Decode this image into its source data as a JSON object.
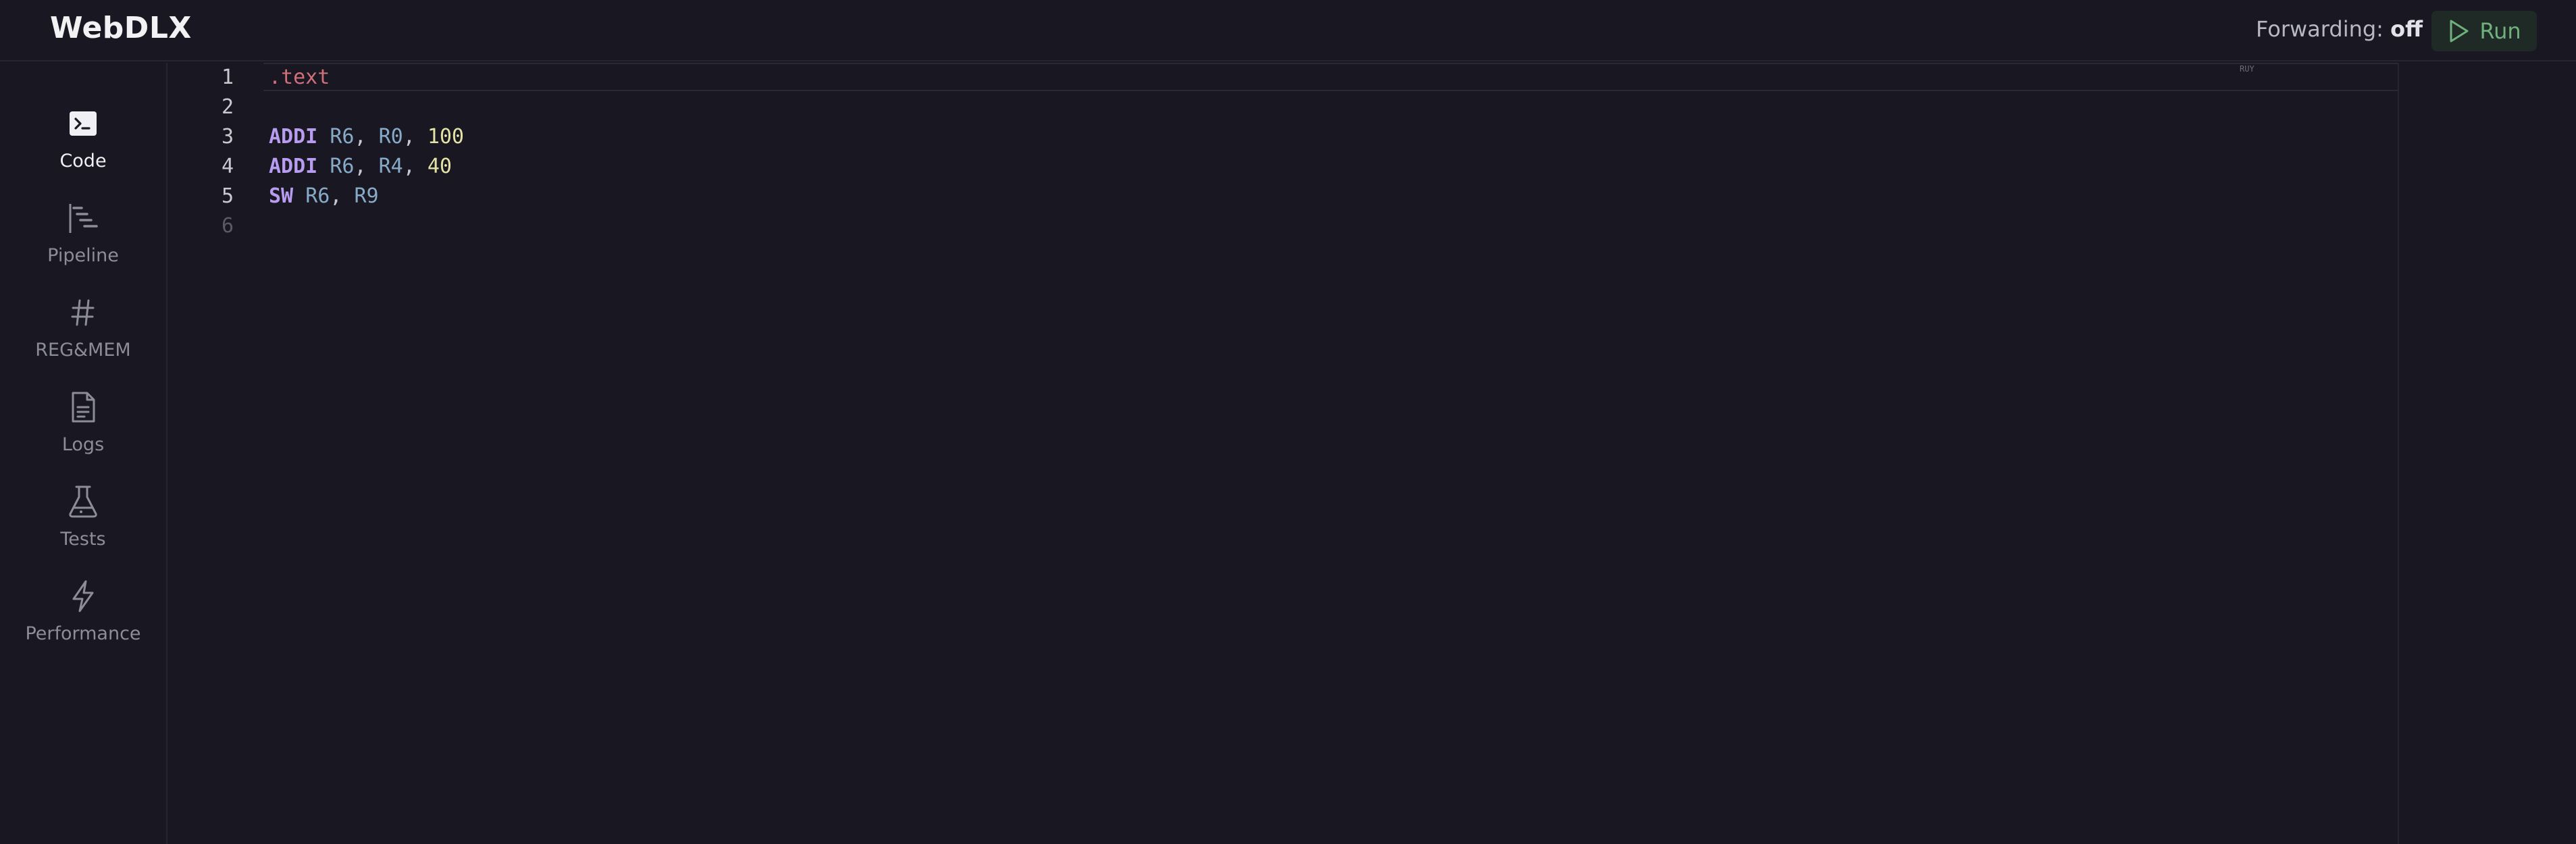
{
  "header": {
    "brand": "WebDLX",
    "forwarding_label": "Forwarding:",
    "forwarding_value": "off",
    "run_label": "Run"
  },
  "sidebar": {
    "items": [
      {
        "label": "Code",
        "icon": "terminal-icon",
        "active": true
      },
      {
        "label": "Pipeline",
        "icon": "pipeline-icon",
        "active": false
      },
      {
        "label": "REG&MEM",
        "icon": "hash-icon",
        "active": false
      },
      {
        "label": "Logs",
        "icon": "file-text-icon",
        "active": false
      },
      {
        "label": "Tests",
        "icon": "flask-icon",
        "active": false
      },
      {
        "label": "Performance",
        "icon": "zap-icon",
        "active": false
      }
    ]
  },
  "editor": {
    "minimap_text": "RUY",
    "lines": [
      {
        "number": "1",
        "tokens": [
          {
            "t": ".text",
            "k": "dir"
          }
        ]
      },
      {
        "number": "2",
        "tokens": []
      },
      {
        "number": "3",
        "tokens": [
          {
            "t": "ADDI",
            "k": "kw"
          },
          {
            "t": " ",
            "k": "pun"
          },
          {
            "t": "R6",
            "k": "reg"
          },
          {
            "t": ", ",
            "k": "pun"
          },
          {
            "t": "R0",
            "k": "reg"
          },
          {
            "t": ", ",
            "k": "pun"
          },
          {
            "t": "100",
            "k": "num"
          }
        ]
      },
      {
        "number": "4",
        "tokens": [
          {
            "t": "ADDI",
            "k": "kw"
          },
          {
            "t": " ",
            "k": "pun"
          },
          {
            "t": "R6",
            "k": "reg"
          },
          {
            "t": ", ",
            "k": "pun"
          },
          {
            "t": "R4",
            "k": "reg"
          },
          {
            "t": ", ",
            "k": "pun"
          },
          {
            "t": "40",
            "k": "num"
          }
        ]
      },
      {
        "number": "5",
        "tokens": [
          {
            "t": "SW",
            "k": "kw"
          },
          {
            "t": " ",
            "k": "pun"
          },
          {
            "t": "R6",
            "k": "reg"
          },
          {
            "t": ", ",
            "k": "pun"
          },
          {
            "t": "R9",
            "k": "reg"
          }
        ]
      },
      {
        "number": "6",
        "tokens": []
      }
    ]
  },
  "colors": {
    "background": "#181722",
    "run_accent": "#6fb07d",
    "directive": "#d0707a",
    "keyword": "#b79cf0",
    "register": "#86aac8",
    "number": "#e3e3a6"
  }
}
